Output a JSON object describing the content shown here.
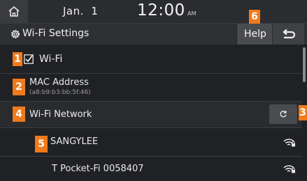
{
  "status_bar": {
    "date": "Jan.  1",
    "time": "12:00",
    "ampm": "AM",
    "home_icon": "home-icon"
  },
  "header": {
    "title": "Wi-Fi Settings",
    "title_icon": "gear-icon",
    "help_label": "Help",
    "back_icon": "back-arrow-icon"
  },
  "list": {
    "wifi": {
      "label": "Wi-Fi",
      "checked": true
    },
    "mac": {
      "label": "MAC Address",
      "value": "(a8:b9:b3:bb:5f:46)"
    },
    "network_header": {
      "label": "Wi-Fi Network",
      "refresh_icon": "refresh-icon"
    },
    "networks": [
      {
        "name": "SANGYLEE",
        "icon": "wifi-locked-icon"
      },
      {
        "name": "T Pocket-Fi 0058407",
        "icon": "wifi-locked-icon"
      }
    ]
  },
  "markers": [
    "1",
    "2",
    "3",
    "4",
    "5",
    "6"
  ],
  "colors": {
    "marker": "#f07a1c",
    "background": "#202124",
    "button": "#4a4b4f"
  }
}
